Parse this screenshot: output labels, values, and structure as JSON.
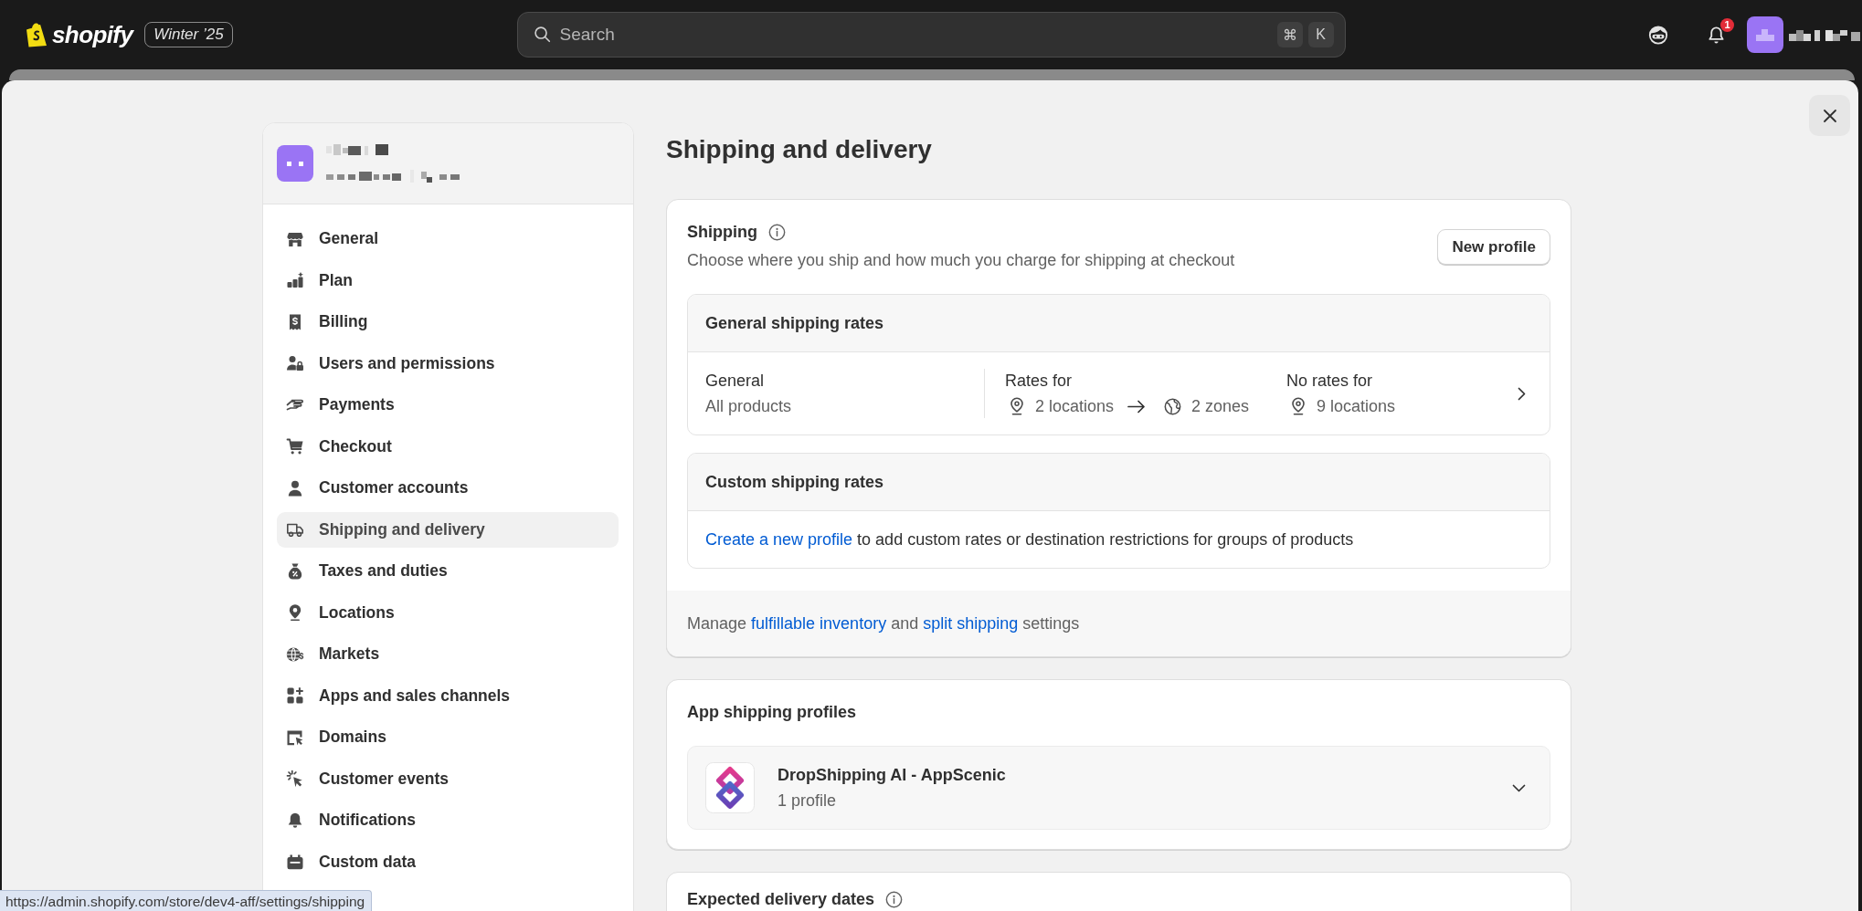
{
  "top_bar": {
    "logo_text": "shopify",
    "edition_badge": "Winter ’25",
    "search": {
      "placeholder": "Search",
      "shortcut_keys": [
        "⌘",
        "K"
      ]
    },
    "notification_count": "1"
  },
  "sidebar": {
    "items": [
      {
        "label": "General",
        "selected": false
      },
      {
        "label": "Plan",
        "selected": false
      },
      {
        "label": "Billing",
        "selected": false
      },
      {
        "label": "Users and permissions",
        "selected": false
      },
      {
        "label": "Payments",
        "selected": false
      },
      {
        "label": "Checkout",
        "selected": false
      },
      {
        "label": "Customer accounts",
        "selected": false
      },
      {
        "label": "Shipping and delivery",
        "selected": true
      },
      {
        "label": "Taxes and duties",
        "selected": false
      },
      {
        "label": "Locations",
        "selected": false
      },
      {
        "label": "Markets",
        "selected": false
      },
      {
        "label": "Apps and sales channels",
        "selected": false
      },
      {
        "label": "Domains",
        "selected": false
      },
      {
        "label": "Customer events",
        "selected": false
      },
      {
        "label": "Notifications",
        "selected": false
      },
      {
        "label": "Custom data",
        "selected": false
      }
    ]
  },
  "page": {
    "title": "Shipping and delivery"
  },
  "shipping_card": {
    "title": "Shipping",
    "description": "Choose where you ship and how much you charge for shipping at checkout",
    "new_profile_button": "New profile",
    "general_rates": {
      "title": "General shipping rates",
      "profile_name": "General",
      "profile_scope": "All products",
      "rates_for_label": "Rates for",
      "rate_locations": "2 locations",
      "rate_zones": "2 zones",
      "no_rates_label": "No rates for",
      "no_rate_locations": "9 locations"
    },
    "custom_rates": {
      "title": "Custom shipping rates",
      "text": [
        {
          "kind": "link",
          "text": "Create a new profile"
        },
        {
          "kind": "text",
          "text": " to add custom rates or destination restrictions for groups of products"
        }
      ]
    },
    "footer": [
      {
        "kind": "text",
        "text": "Manage "
      },
      {
        "kind": "link",
        "text": "fulfillable inventory"
      },
      {
        "kind": "text",
        "text": " and "
      },
      {
        "kind": "link",
        "text": "split shipping"
      },
      {
        "kind": "text",
        "text": " settings"
      }
    ]
  },
  "app_profiles_card": {
    "title": "App shipping profiles",
    "apps": [
      {
        "name": "DropShipping AI - AppScenic",
        "detail": "1 profile",
        "expanded": false
      }
    ]
  },
  "delivery_dates_card": {
    "title": "Expected delivery dates"
  },
  "status_url": "https://admin.shopify.com/store/dev4-aff/settings/shipping"
}
